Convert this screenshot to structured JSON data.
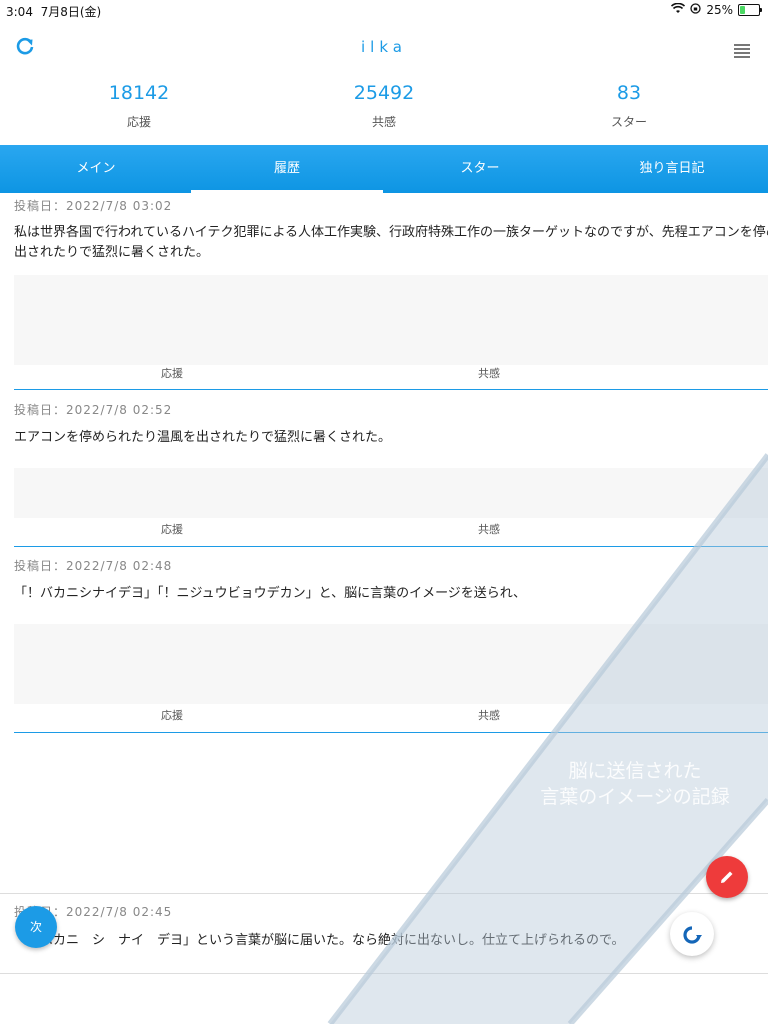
{
  "status_bar": {
    "time": "3:04",
    "date": "7月8日(金)",
    "battery": "25%"
  },
  "header": {
    "title": "ilka"
  },
  "stats": [
    {
      "value": "18142",
      "label": "応援"
    },
    {
      "value": "25492",
      "label": "共感"
    },
    {
      "value": "83",
      "label": "スター"
    }
  ],
  "tabs": [
    {
      "label": "メイン"
    },
    {
      "label": "履歴"
    },
    {
      "label": "スター"
    },
    {
      "label": "独り言日記"
    }
  ],
  "posts": [
    {
      "date": "投稿日：2022/7/8 03:02",
      "line1": "私は世界各国で行われているハイテク犯罪による人体工作実験、行政府特殊工作の一族ターゲットなのですが、先程エアコンを停められたり温風を",
      "line2": "出されたりで猛烈に暑くされた。",
      "support": "応援",
      "empathy": "共感"
    },
    {
      "date": "投稿日：2022/7/8 02:52",
      "line1": "エアコンを停められたり温風を出されたりで猛烈に暑くされた。",
      "support": "応援",
      "empathy": "共感"
    },
    {
      "date": "投稿日：2022/7/8 02:48",
      "line1": "「！バカニシナイデヨ」「！ニジュウビョウデカン」と、脳に言葉のイメージを送られ、",
      "support": "応援",
      "empathy": "共感"
    },
    {
      "date": "投稿日：2022/7/8 02:45",
      "line1": "「！バカニ　シ　ナイ　デヨ」という言葉が脳に届いた。なら絶対に出ないし。仕立て上げられるので。"
    }
  ],
  "watermark": {
    "line1": "脳に送信された",
    "line2": "言葉のイメージの記録"
  },
  "buttons": {
    "next_label": "次"
  },
  "icons": {
    "refresh": "refresh-icon",
    "menu": "menu-icon",
    "edit": "pencil-icon",
    "reload": "reload-icon"
  },
  "colors": {
    "accent": "#1c9be6",
    "fab_edit": "#ee3b3b"
  }
}
